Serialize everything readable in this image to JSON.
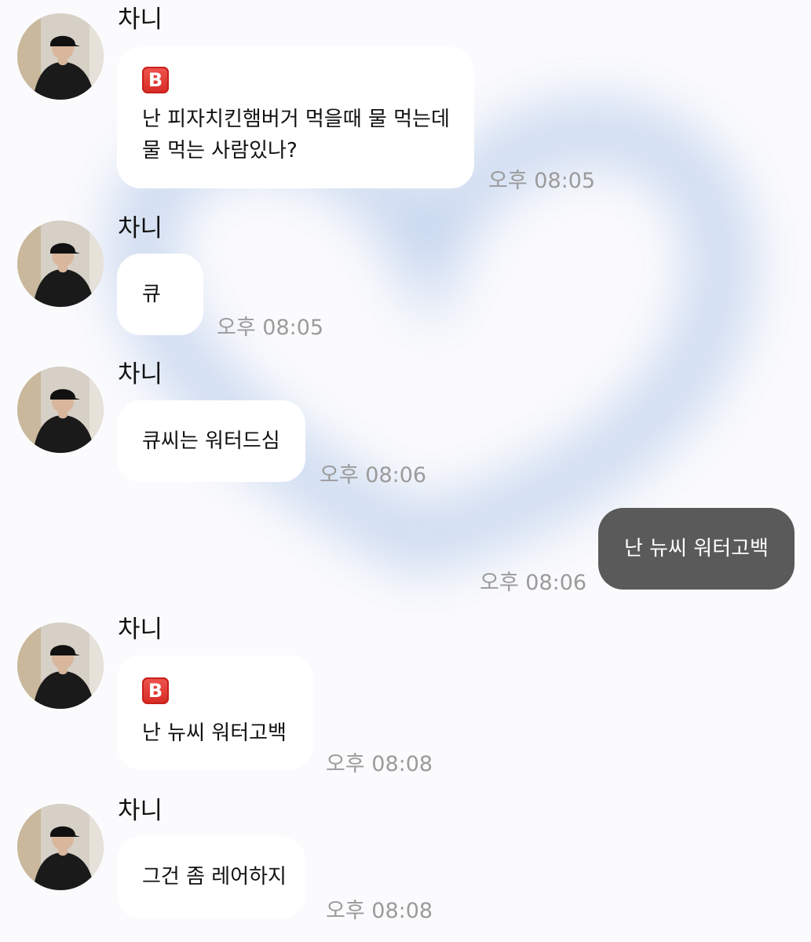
{
  "chat": {
    "messages": [
      {
        "sender": "차니",
        "badge": "B",
        "lines": [
          "난 피자치킨햄버거 먹을때 물 먹는데",
          "물 먹는 사람있나?"
        ],
        "time": "오후 08:05"
      },
      {
        "sender": "차니",
        "lines": [
          "큐"
        ],
        "time": "오후 08:05"
      },
      {
        "sender": "차니",
        "lines": [
          "큐씨는 워터드심"
        ],
        "time": "오후 08:06"
      },
      {
        "mine": true,
        "text": "난 뉴씨 워터고백",
        "time": "오후 08:06"
      },
      {
        "sender": "차니",
        "badge": "B",
        "lines": [
          "난 뉴씨 워터고백"
        ],
        "time": "오후 08:08"
      },
      {
        "sender": "차니",
        "lines": [
          "그건 좀 레어하지"
        ],
        "time": "오후 08:08"
      }
    ]
  },
  "colors": {
    "background": "#fbfbfd",
    "incoming_bubble": "#ffffff",
    "outgoing_bubble": "#5a5a5a",
    "timestamp": "#9b9b9b",
    "badge": "#e03a34",
    "heart_glow": "#b9cdeb"
  },
  "icons": {
    "badge": "b-button-emoji",
    "avatar": "profile-photo"
  }
}
